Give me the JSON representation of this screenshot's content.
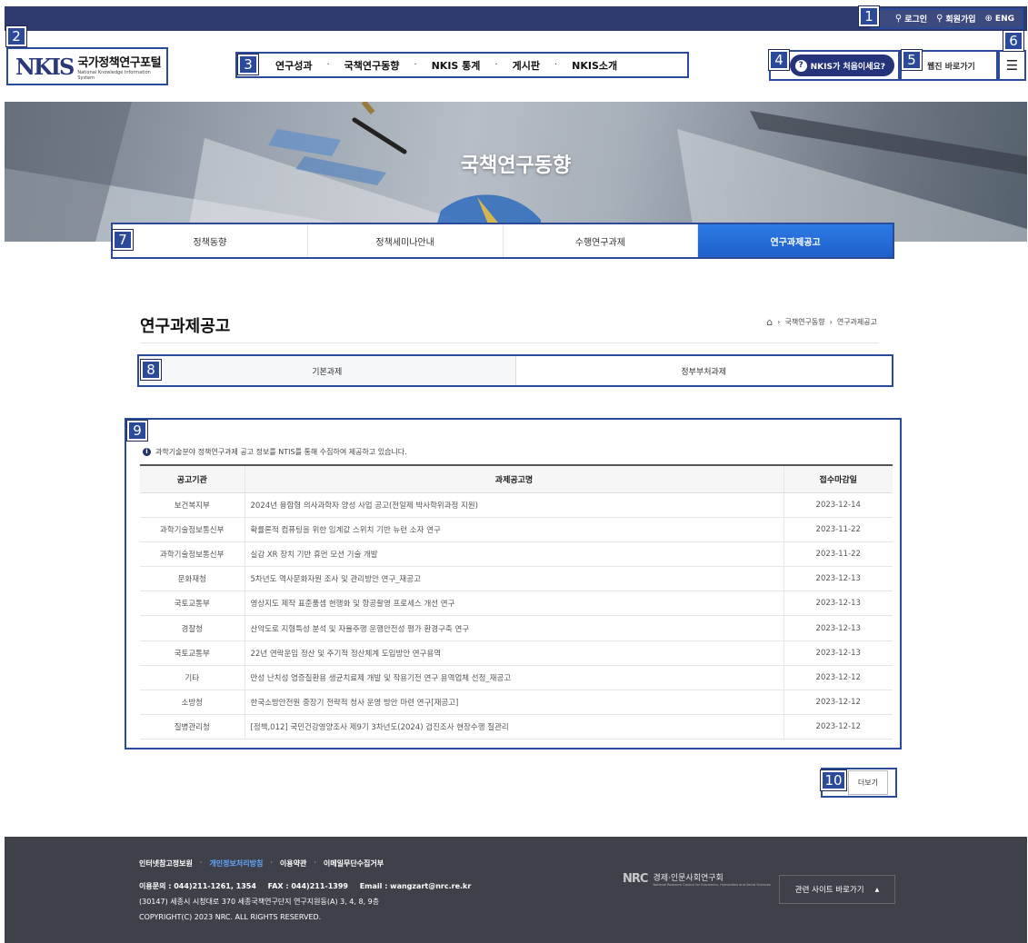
{
  "utility": {
    "login": "로그인",
    "signup": "회원가입",
    "lang": "ENG"
  },
  "logo": {
    "mark": "NKIS",
    "title": "국가정책연구포털",
    "subtitle": "National Knowledge Information System"
  },
  "gnb": {
    "items": [
      "연구성과",
      "국책연구동향",
      "NKIS 통계",
      "게시판",
      "NKIS소개"
    ]
  },
  "header": {
    "help_label": "NKIS가 처음이세요?",
    "webzine_label": "웹진 바로가기",
    "menu_icon": "☰"
  },
  "hero": {
    "title": "국책연구동향"
  },
  "subnav": {
    "tabs": [
      "정책동향",
      "정책세미나안내",
      "수행연구과제",
      "연구과제공고"
    ],
    "active_index": 3
  },
  "page": {
    "title": "연구과제공고",
    "breadcrumb": [
      "국책연구동향",
      "연구과제공고"
    ]
  },
  "segment": {
    "tabs": [
      "기본과제",
      "정부부처과제"
    ],
    "active_index": 0
  },
  "table": {
    "notice": "과학기술분야 정책연구과제 공고 정보를 NTIS를 통해 수집하여 제공하고 있습니다.",
    "columns": [
      "공고기관",
      "과제공고명",
      "접수마감일"
    ],
    "rows": [
      {
        "org": "보건복지부",
        "title": "2024년 융합형 의사과학자 양성 사업 공고(전일제 박사학위과정 지원)",
        "date": "2023-12-14"
      },
      {
        "org": "과학기술정보통신부",
        "title": "확률론적 컴퓨팅을 위한 임계값 스위치 기반 뉴런 소자 연구",
        "date": "2023-11-22"
      },
      {
        "org": "과학기술정보통신부",
        "title": "실감 XR 장치 기반 휴먼 모션 기술 개발",
        "date": "2023-11-22"
      },
      {
        "org": "문화재청",
        "title": "5차년도 역사문화자원 조사 및 관리방안 연구_재공고",
        "date": "2023-12-13"
      },
      {
        "org": "국토교통부",
        "title": "영상지도 제작 표준품셈 현행화 및 항공촬영 프로세스 개선 연구",
        "date": "2023-12-13"
      },
      {
        "org": "경찰청",
        "title": "산악도로 지형특성 분석 및 자율주행 운행안전성 평가 환경구축 연구",
        "date": "2023-12-13"
      },
      {
        "org": "국토교통부",
        "title": "22년 연락운임 정산 및 주기적 정산체계 도입방안 연구용역",
        "date": "2023-12-13"
      },
      {
        "org": "기타",
        "title": "만성 난치성 염증질환용 생균치료제 개발 및 작용기전 연구 용역업체 선정_재공고",
        "date": "2023-12-12"
      },
      {
        "org": "소방청",
        "title": "한국소방안전원 중장기 전략적 청사 운영 방안 마련 연구[재공고]",
        "date": "2023-12-12"
      },
      {
        "org": "질병관리청",
        "title": "[정책,012] 국민건강영양조사 제9기 3차년도(2024) 검진조사 현장수행 질관리",
        "date": "2023-12-12"
      }
    ]
  },
  "more_label": "더보기",
  "footer": {
    "links": [
      "인터넷참고정보원",
      "개인정보처리방침",
      "이용약관",
      "이메일무단수집거부"
    ],
    "highlight_index": 1,
    "contact_label": "이용문의 : 044)211-1261, 1354",
    "fax_label": "FAX : 044)211-1399",
    "email_label": "Email : wangzart@nrc.re.kr",
    "address": "(30147) 세종시 시청대로 370 세종국책연구단지 연구지원동(A) 3, 4, 8, 9층",
    "copyright": "COPYRIGHT(C) 2023 NRC. ALL RIGHTS RESERVED.",
    "nrc_mark": "NRC",
    "nrc_name": "경제·인문사회연구회",
    "nrc_english": "National Research Council for Economics, Humanities and Social Sciences",
    "related_label": "관련 사이트 바로가기",
    "related_icon": "▲"
  },
  "annotations": [
    "1",
    "2",
    "3",
    "4",
    "5",
    "6",
    "7",
    "8",
    "9",
    "10"
  ],
  "colors": {
    "accent": "#2b4a9a",
    "active_tab": "#2c7be5",
    "topbar": "#2e3a6e",
    "footer": "#3e414a"
  }
}
